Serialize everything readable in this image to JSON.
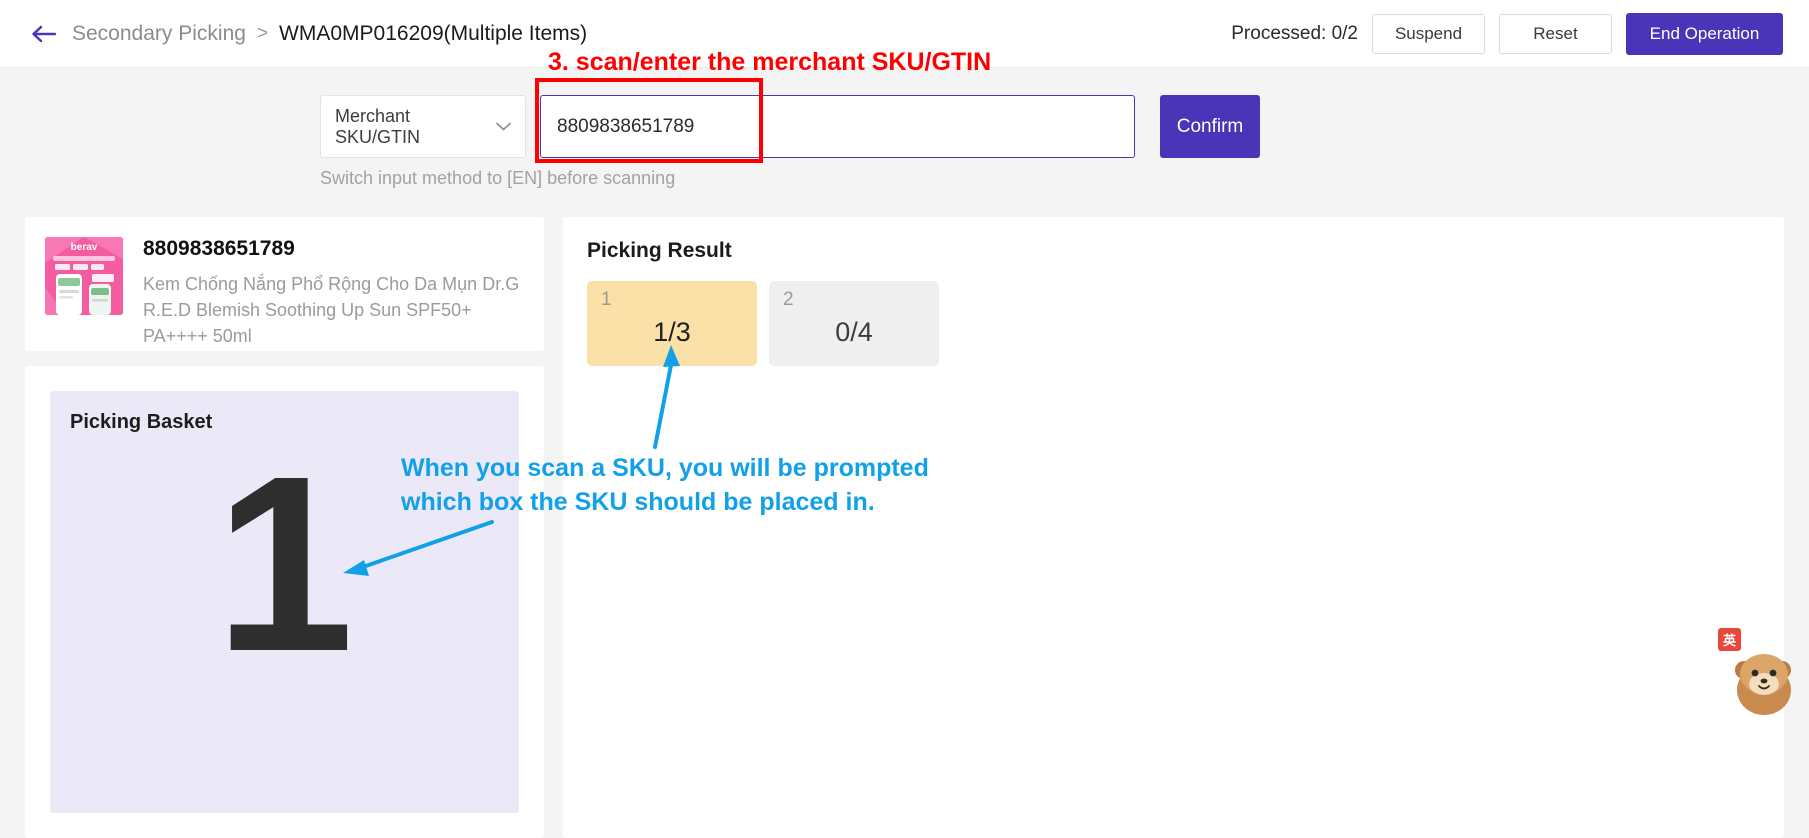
{
  "header": {
    "back_icon": "arrow-left-icon",
    "breadcrumb_parent": "Secondary Picking",
    "breadcrumb_separator": ">",
    "breadcrumb_current": "WMA0MP016209(Multiple Items)",
    "processed_label": "Processed: 0/2",
    "suspend_label": "Suspend",
    "reset_label": "Reset",
    "end_operation_label": "End Operation"
  },
  "scan": {
    "select_value": "Merchant SKU/GTIN",
    "select_chevron_icon": "chevron-down-icon",
    "input_value": "8809838651789",
    "input_placeholder": "",
    "confirm_label": "Confirm",
    "helper_text": "Switch input method to [EN] before scanning"
  },
  "product": {
    "sku": "8809838651789",
    "description": "Kem Chống Nắng Phổ Rộng Cho Da Mụn Dr.G R.E.D Blemish Soothing Up Sun SPF50+ PA++++ 50ml",
    "thumbnail_icon": "product-thumbnail-sunscreen"
  },
  "picking_result": {
    "title": "Picking Result",
    "boxes": [
      {
        "index": "1",
        "count": "1/3",
        "state": "active"
      },
      {
        "index": "2",
        "count": "0/4",
        "state": "idle"
      }
    ]
  },
  "basket": {
    "title": "Picking Basket",
    "number": "1"
  },
  "annotations": {
    "red_text": "3. scan/enter the merchant SKU/GTIN",
    "blue_line1": "When you scan a SKU, you will be prompted",
    "blue_line2": "which box the SKU should be placed in."
  },
  "mascot": {
    "badge_text": "英",
    "icon": "assistant-mascot-icon"
  },
  "colors": {
    "accent_purple": "#4A34B8",
    "annotation_red": "#FF0000",
    "annotation_blue": "#12A0E8",
    "box_active_yellow": "#FBE0A7",
    "box_idle_grey": "#EFEFEF",
    "basket_lavender": "#EBE9F8"
  }
}
